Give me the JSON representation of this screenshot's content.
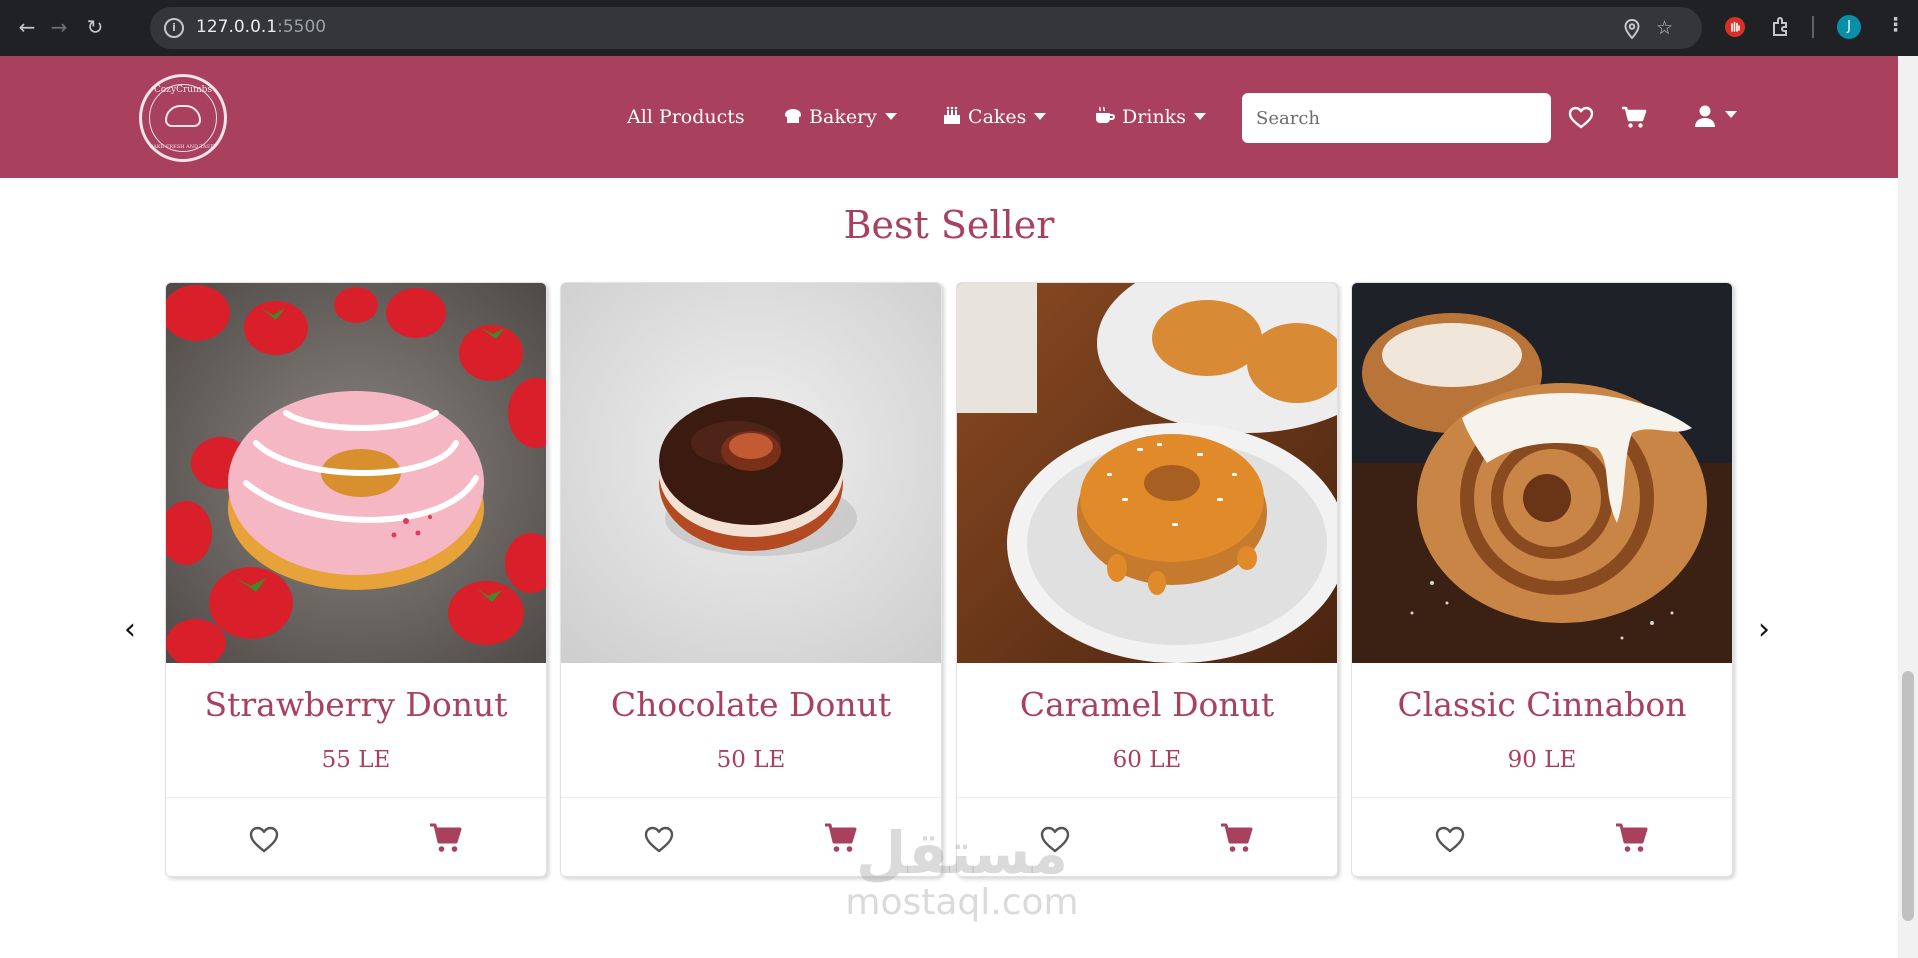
{
  "browser": {
    "url_host": "127.0.0.1",
    "url_port": ":5500",
    "avatar_letter": "J"
  },
  "navbar": {
    "logo_text": "CozyCrumbs",
    "logo_subtext": "BAKE FRESH AND TASTY",
    "links": [
      {
        "label": "All Products",
        "icon": ""
      },
      {
        "label": "Bakery",
        "icon": "bread-icon"
      },
      {
        "label": "Cakes",
        "icon": "birthday-cake-icon"
      },
      {
        "label": "Drinks",
        "icon": "mug-icon"
      }
    ],
    "search_placeholder": "Search"
  },
  "section": {
    "title": "Best Seller"
  },
  "carousel": {
    "prev": "‹",
    "next": "›"
  },
  "products": [
    {
      "name": "Strawberry Donut",
      "price": "55 LE"
    },
    {
      "name": "Chocolate Donut",
      "price": "50 LE"
    },
    {
      "name": "Caramel Donut",
      "price": "60 LE"
    },
    {
      "name": "Classic Cinnabon",
      "price": "90 LE"
    }
  ],
  "colors": {
    "brand": "#a8405e",
    "chrome": "#202124"
  },
  "watermark": {
    "arabic": "مستقل",
    "latin": "mostaql.com"
  }
}
